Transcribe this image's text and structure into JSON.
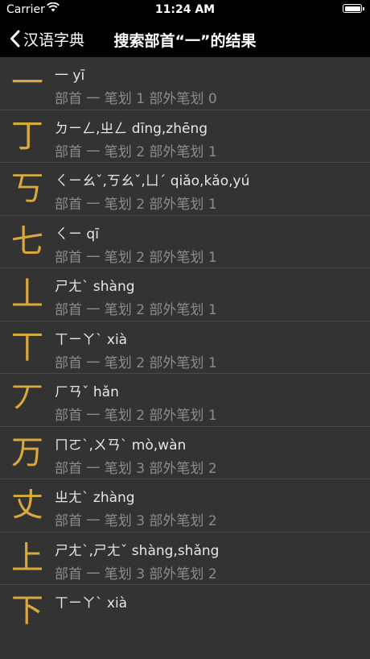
{
  "status": {
    "carrier": "Carrier",
    "time": "11:24 AM"
  },
  "nav": {
    "back_label": "汉语字典",
    "title": "搜索部首“一”的结果"
  },
  "rows": [
    {
      "char": "一",
      "reading": "一  yī",
      "meta": "部首 一  笔划 1  部外笔划 0"
    },
    {
      "char": "丁",
      "reading": "ㄉㄧㄥ,ㄓㄥ  dīng,zhēng",
      "meta": "部首 一  笔划 2  部外笔划 1"
    },
    {
      "char": "丂",
      "reading": "ㄑㄧㄠˇ,ㄎㄠˇ,ㄩˊ  qiǎo,kǎo,yú",
      "meta": "部首 一  笔划 2  部外笔划 1"
    },
    {
      "char": "七",
      "reading": "ㄑㄧ  qī",
      "meta": "部首 一  笔划 2  部外笔划 1"
    },
    {
      "char": "丄",
      "reading": "ㄕㄤˋ  shàng",
      "meta": "部首 一  笔划 2  部外笔划 1"
    },
    {
      "char": "丅",
      "reading": "ㄒㄧㄚˋ  xià",
      "meta": "部首 一  笔划 2  部外笔划 1"
    },
    {
      "char": "丆",
      "reading": "ㄏㄢˇ  hǎn",
      "meta": "部首 一  笔划 2  部外笔划 1"
    },
    {
      "char": "万",
      "reading": "ㄇㄛˋ,ㄨㄢˋ  mò,wàn",
      "meta": "部首 一  笔划 3  部外笔划 2"
    },
    {
      "char": "丈",
      "reading": "ㄓㄤˋ  zhàng",
      "meta": "部首 一  笔划 3  部外笔划 2"
    },
    {
      "char": "上",
      "reading": "ㄕㄤˋ,ㄕㄤˇ  shàng,shǎng",
      "meta": "部首 一  笔划 3  部外笔划 2"
    },
    {
      "char": "下",
      "reading": "ㄒㄧㄚˋ  xià",
      "meta": ""
    }
  ]
}
